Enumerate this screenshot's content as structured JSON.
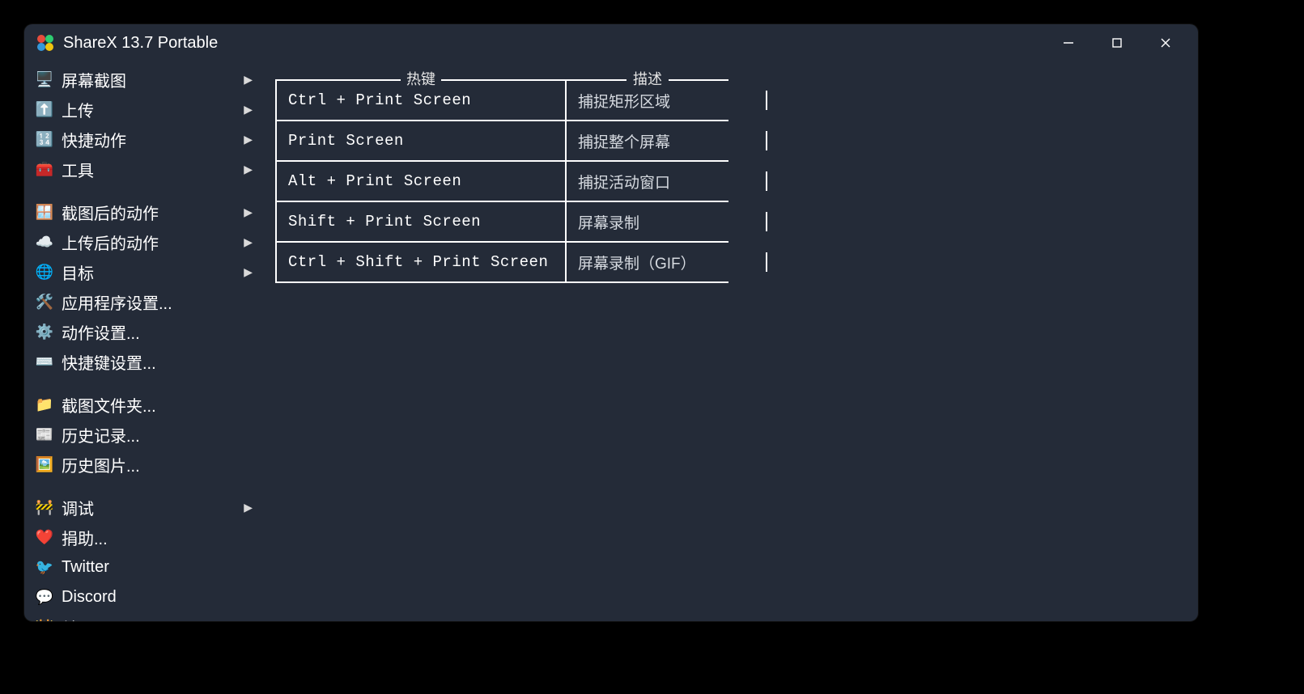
{
  "window": {
    "title": "ShareX 13.7 Portable"
  },
  "sidebar": {
    "groups": [
      [
        {
          "icon": "display-icon",
          "emoji": "🖥️",
          "label": "屏幕截图",
          "submenu": true
        },
        {
          "icon": "upload-icon",
          "emoji": "⬆️",
          "label": "上传",
          "submenu": true
        },
        {
          "icon": "grid-icon",
          "emoji": "🔢",
          "label": "快捷动作",
          "submenu": true
        },
        {
          "icon": "toolbox-icon",
          "emoji": "🧰",
          "label": "工具",
          "submenu": true
        }
      ],
      [
        {
          "icon": "window-icon",
          "emoji": "🪟",
          "label": "截图后的动作",
          "submenu": true
        },
        {
          "icon": "cloud-icon",
          "emoji": "☁️",
          "label": "上传后的动作",
          "submenu": true
        },
        {
          "icon": "target-icon",
          "emoji": "🌐",
          "label": "目标",
          "submenu": true
        },
        {
          "icon": "wrench-icon",
          "emoji": "🛠️",
          "label": "应用程序设置...",
          "submenu": false
        },
        {
          "icon": "gear-icon",
          "emoji": "⚙️",
          "label": "动作设置...",
          "submenu": false
        },
        {
          "icon": "keyboard-icon",
          "emoji": "⌨️",
          "label": "快捷键设置...",
          "submenu": false
        }
      ],
      [
        {
          "icon": "folder-icon",
          "emoji": "📁",
          "label": "截图文件夹...",
          "submenu": false
        },
        {
          "icon": "history-icon",
          "emoji": "📰",
          "label": "历史记录...",
          "submenu": false
        },
        {
          "icon": "image-history-icon",
          "emoji": "🖼️",
          "label": "历史图片...",
          "submenu": false
        }
      ],
      [
        {
          "icon": "debug-icon",
          "emoji": "🚧",
          "label": "调试",
          "submenu": true
        },
        {
          "icon": "heart-icon",
          "emoji": "❤️",
          "label": "捐助...",
          "submenu": false
        },
        {
          "icon": "twitter-icon",
          "emoji": "🐦",
          "label": "Twitter",
          "submenu": false
        },
        {
          "icon": "discord-icon",
          "emoji": "💬",
          "label": "Discord",
          "submenu": false
        },
        {
          "icon": "about-icon",
          "emoji": "👑",
          "label": "关于...",
          "submenu": false
        }
      ]
    ]
  },
  "hotkeys": {
    "header_key": "热键",
    "header_desc": "描述",
    "rows": [
      {
        "key": "Ctrl + Print Screen",
        "desc": "捕捉矩形区域"
      },
      {
        "key": "Print Screen",
        "desc": "捕捉整个屏幕"
      },
      {
        "key": "Alt + Print Screen",
        "desc": "捕捉活动窗口"
      },
      {
        "key": "Shift + Print Screen",
        "desc": "屏幕录制"
      },
      {
        "key": "Ctrl + Shift + Print Screen",
        "desc": "屏幕录制（GIF）"
      }
    ]
  }
}
